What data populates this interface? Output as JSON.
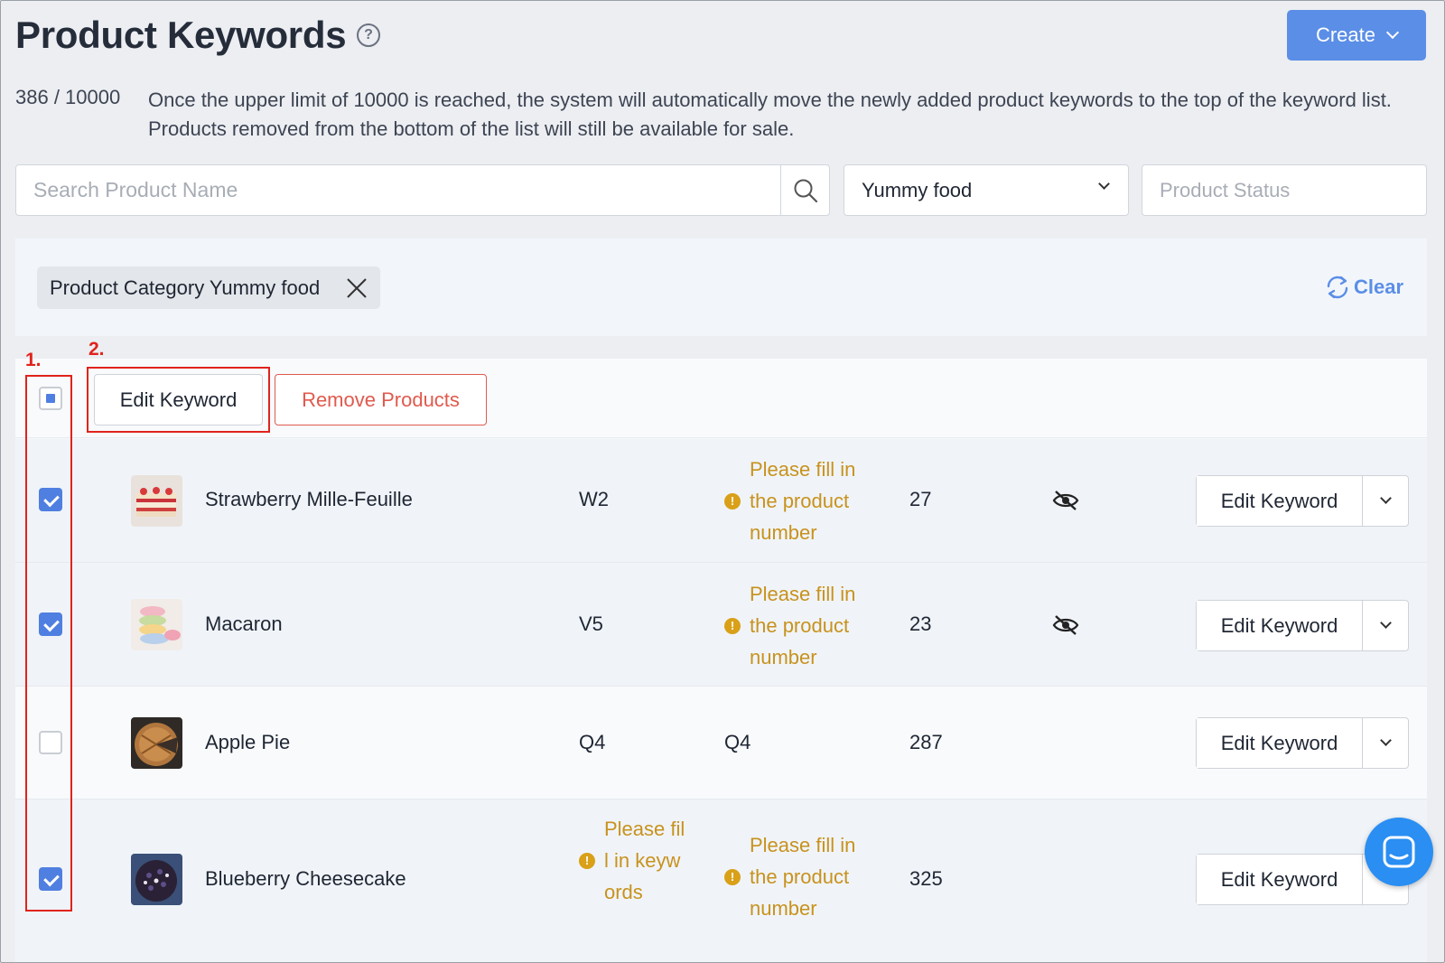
{
  "header": {
    "title": "Product Keywords",
    "help_icon": "?",
    "create_label": "Create"
  },
  "limit": {
    "count": "386 / 10000",
    "notice": "Once the upper limit of 10000 is reached, the system will automatically move the newly added product keywords to the top of the keyword list. Products removed from the bottom of the list will still be available for sale."
  },
  "filters": {
    "search_placeholder": "Search Product Name",
    "category_value": "Yummy food",
    "status_placeholder": "Product Status"
  },
  "active_filter": {
    "chip_label": "Product Category Yummy food",
    "clear_label": "Clear"
  },
  "bulk": {
    "edit_label": "Edit Keyword",
    "remove_label": "Remove Products"
  },
  "annotations": {
    "label_1": "1.",
    "label_2": "2.",
    "color": "#e0231c"
  },
  "rows": [
    {
      "name": "Strawberry Mille-Feuille",
      "keyword": "W2",
      "product_number_warning": "Please fill in the product number",
      "count": "27",
      "hidden_icon": "eye-slash-icon",
      "checked": true,
      "action_label": "Edit Keyword"
    },
    {
      "name": "Macaron",
      "keyword": "V5",
      "product_number_warning": "Please fill in the product number",
      "count": "23",
      "hidden_icon": "eye-slash-icon",
      "checked": true,
      "action_label": "Edit Keyword"
    },
    {
      "name": "Apple Pie",
      "keyword": "Q4",
      "product_number": "Q4",
      "count": "287",
      "checked": false,
      "action_label": "Edit Keyword"
    },
    {
      "name": "Blueberry Cheesecake",
      "keyword_warning": "Please fill in keywords",
      "product_number_warning": "Please fill in the product number",
      "count": "325",
      "checked": true,
      "action_label": "Edit Keyword"
    }
  ],
  "colors": {
    "accent": "#5b8ee6",
    "warning": "#c8921d",
    "danger": "#e05a4e",
    "checkbox": "#4f7fe0"
  }
}
